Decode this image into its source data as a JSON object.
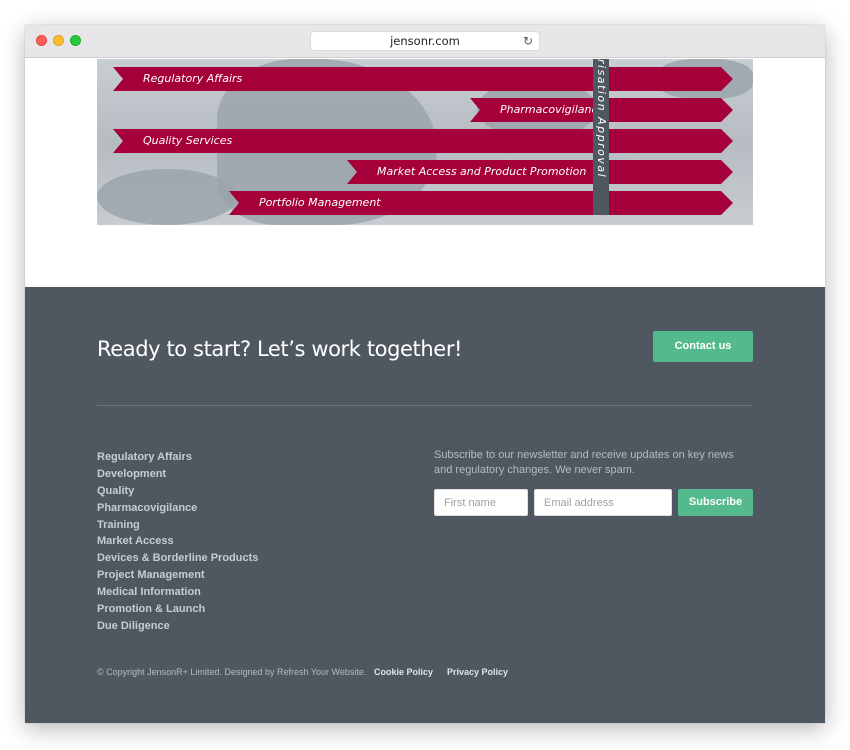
{
  "browser": {
    "url": "jensonr.com",
    "reload_glyph": "↻"
  },
  "banner": {
    "ribbons": [
      {
        "label": "Regulatory Affairs"
      },
      {
        "label": "Pharmacovigilance"
      },
      {
        "label": "Quality Services"
      },
      {
        "label": "Market Access and Product Promotion"
      },
      {
        "label": "Portfolio Management"
      }
    ],
    "vertical_label": "risation Approval"
  },
  "footer": {
    "cta_title": "Ready to start? Let’s work together!",
    "contact_label": "Contact us",
    "links": [
      "Regulatory Affairs",
      "Development",
      "Quality",
      "Pharmacovigilance",
      "Training",
      "Market Access",
      "Devices & Borderline Products",
      "Project Management",
      "Medical Information",
      "Promotion & Launch",
      "Due Diligence"
    ],
    "newsletter_text": "Subscribe to our newsletter and receive updates on key news and regulatory changes. We never spam.",
    "first_name_placeholder": "First name",
    "email_placeholder": "Email address",
    "subscribe_label": "Subscribe",
    "copyright": "© Copyright JensonR+ Limited. Designed by Refresh Your Website.",
    "cookie_policy": "Cookie Policy",
    "privacy_policy": "Privacy Policy"
  },
  "colors": {
    "ribbon": "#a5003a",
    "footer_bg": "#4f5860",
    "accent_green": "#54b98c"
  }
}
